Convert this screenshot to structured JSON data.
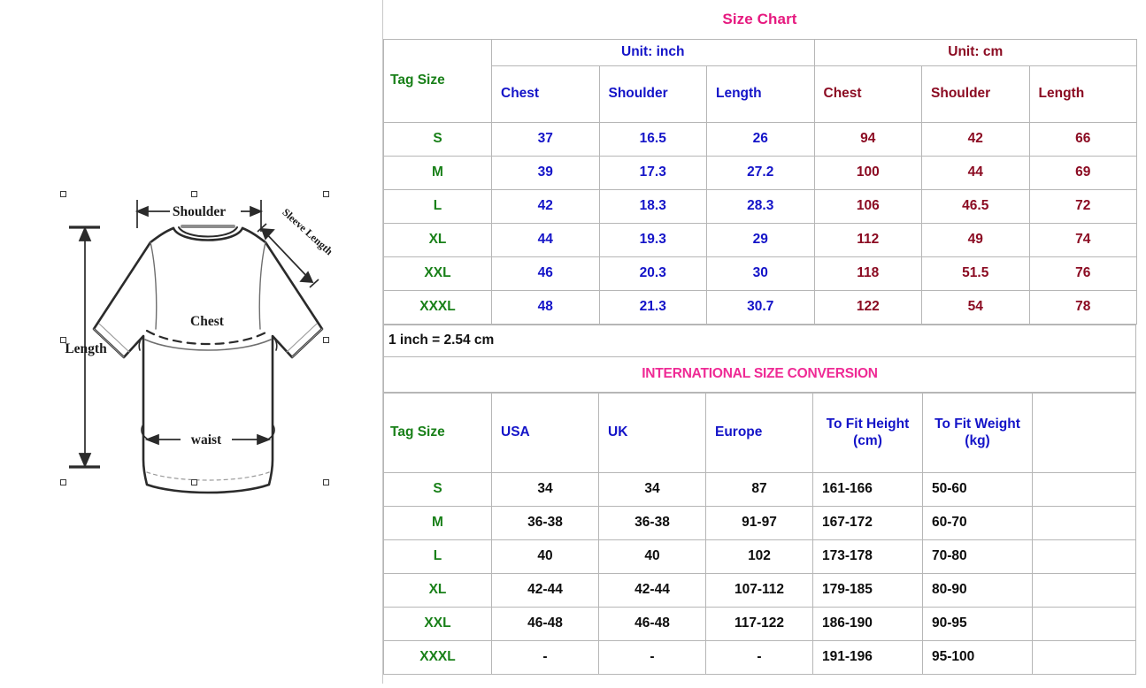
{
  "title": "Size Chart",
  "diagram": {
    "labels": {
      "shoulder": "Shoulder",
      "sleeve_length": "Sleeve Length",
      "chest": "Chest",
      "length": "Length",
      "waist": "waist"
    },
    "alt": "t-shirt-measurement-diagram"
  },
  "colors": {
    "title_pink": "#e6197f",
    "intl_pink": "#ef2a95",
    "green": "#198019",
    "blue": "#1414c8",
    "dark_red": "#8b0b22",
    "black": "#0d0d0d",
    "border": "#b6b6b6"
  },
  "size_table": {
    "tag_size_header": "Tag Size",
    "unit_groups": [
      {
        "label": "Unit: inch"
      },
      {
        "label": "Unit: cm"
      }
    ],
    "sub_headers": [
      "Chest",
      "Shoulder",
      "Length",
      "Chest",
      "Shoulder",
      "Length"
    ],
    "rows": [
      {
        "tag": "S",
        "inch_chest": "37",
        "inch_shoulder": "16.5",
        "inch_length": "26",
        "cm_chest": "94",
        "cm_shoulder": "42",
        "cm_length": "66"
      },
      {
        "tag": "M",
        "inch_chest": "39",
        "inch_shoulder": "17.3",
        "inch_length": "27.2",
        "cm_chest": "100",
        "cm_shoulder": "44",
        "cm_length": "69"
      },
      {
        "tag": "L",
        "inch_chest": "42",
        "inch_shoulder": "18.3",
        "inch_length": "28.3",
        "cm_chest": "106",
        "cm_shoulder": "46.5",
        "cm_length": "72"
      },
      {
        "tag": "XL",
        "inch_chest": "44",
        "inch_shoulder": "19.3",
        "inch_length": "29",
        "cm_chest": "112",
        "cm_shoulder": "49",
        "cm_length": "74"
      },
      {
        "tag": "XXL",
        "inch_chest": "46",
        "inch_shoulder": "20.3",
        "inch_length": "30",
        "cm_chest": "118",
        "cm_shoulder": "51.5",
        "cm_length": "76"
      },
      {
        "tag": "XXXL",
        "inch_chest": "48",
        "inch_shoulder": "21.3",
        "inch_length": "30.7",
        "cm_chest": "122",
        "cm_shoulder": "54",
        "cm_length": "78"
      }
    ]
  },
  "conversion_note": "1 inch = 2.54 cm",
  "conversion_table": {
    "section_title": "INTERNATIONAL SIZE CONVERSION",
    "headers": {
      "tag_size": "Tag Size",
      "usa": "USA",
      "uk": "UK",
      "europe": "Europe",
      "height": "To Fit Height (cm)",
      "weight": "To Fit Weight (kg)",
      "blank": ""
    },
    "rows": [
      {
        "tag": "S",
        "usa": "34",
        "uk": "34",
        "europe": "87",
        "height": "161-166",
        "weight": "50-60",
        "blank": ""
      },
      {
        "tag": "M",
        "usa": "36-38",
        "uk": "36-38",
        "europe": "91-97",
        "height": "167-172",
        "weight": "60-70",
        "blank": ""
      },
      {
        "tag": "L",
        "usa": "40",
        "uk": "40",
        "europe": "102",
        "height": "173-178",
        "weight": "70-80",
        "blank": ""
      },
      {
        "tag": "XL",
        "usa": "42-44",
        "uk": "42-44",
        "europe": "107-112",
        "height": "179-185",
        "weight": "80-90",
        "blank": ""
      },
      {
        "tag": "XXL",
        "usa": "46-48",
        "uk": "46-48",
        "europe": "117-122",
        "height": "186-190",
        "weight": "90-95",
        "blank": ""
      },
      {
        "tag": "XXXL",
        "usa": "-",
        "uk": "-",
        "europe": "-",
        "height": "191-196",
        "weight": "95-100",
        "blank": ""
      }
    ]
  }
}
